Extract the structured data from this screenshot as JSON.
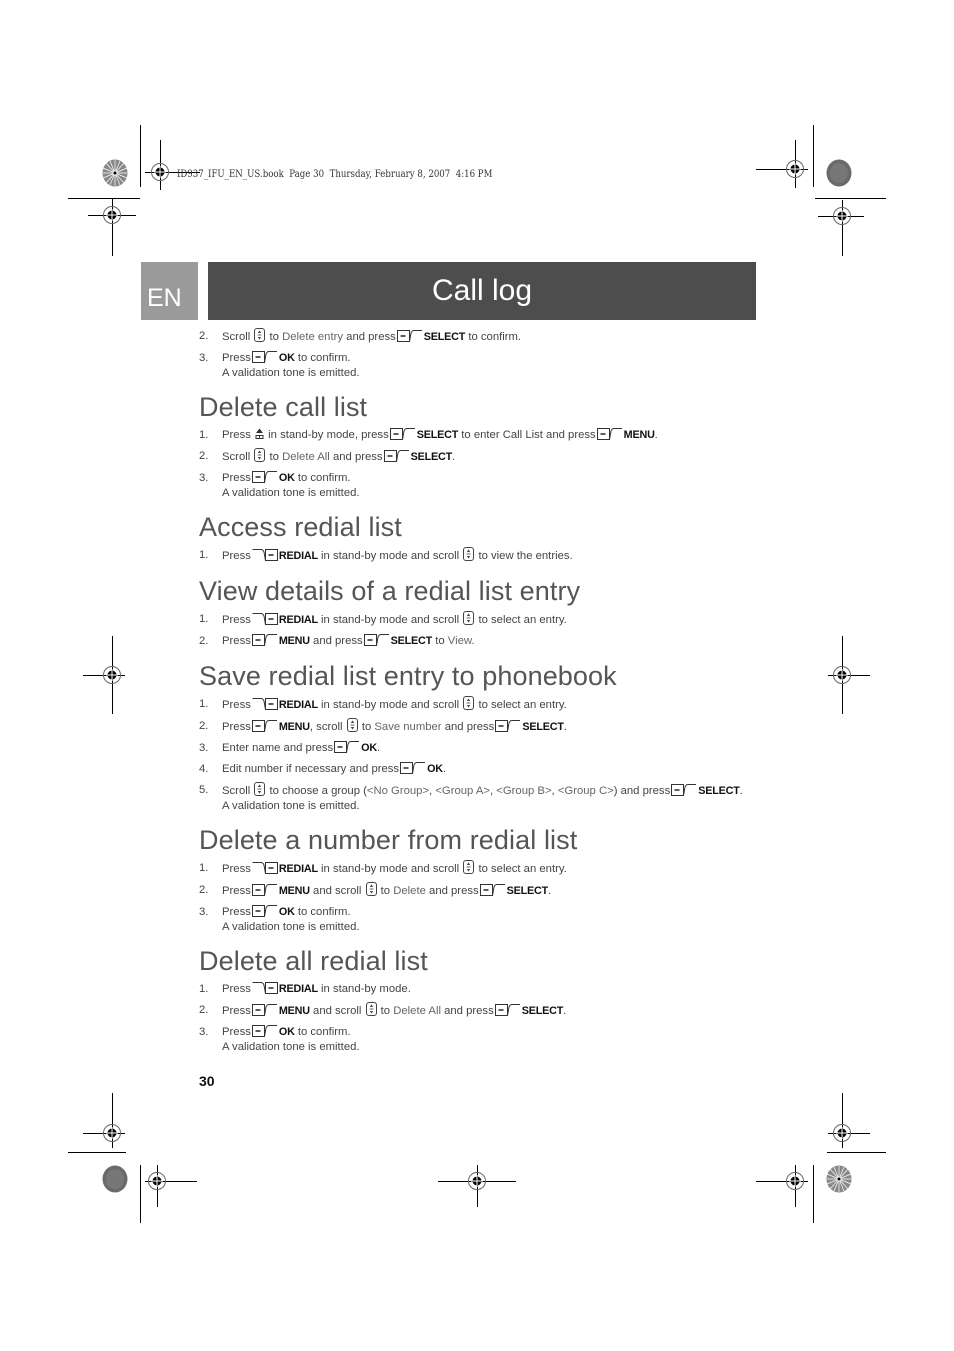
{
  "book_header": "ID937_IFU_EN_US.book  Page 30  Thursday, February 8, 2007  4:16 PM",
  "language_tab": "EN",
  "chapter_title": "Call log",
  "page_number": "30",
  "icons": {
    "scroll": "scroll-key-icon",
    "left_softkey": "left-softkey-icon",
    "right_softkey": "right-softkey-icon",
    "call_log": "call-log-key-icon"
  },
  "intro_steps": [
    {
      "num": "2.",
      "parts": [
        "Scroll",
        "to",
        "Delete entry",
        "and press",
        "SELECT",
        "to confirm."
      ]
    },
    {
      "num": "3.",
      "parts": [
        "Press",
        "OK",
        "to confirm."
      ],
      "note": "A validation tone is emitted."
    }
  ],
  "sections": [
    {
      "title": "Delete call list",
      "steps": [
        {
          "num": "1.",
          "parts": [
            "Press",
            "in stand-by mode, press",
            "SELECT",
            "to enter Call List and press",
            "MENU",
            "."
          ]
        },
        {
          "num": "2.",
          "parts": [
            "Scroll",
            "to",
            "Delete All",
            "and press",
            "SELECT",
            "."
          ]
        },
        {
          "num": "3.",
          "parts": [
            "Press",
            "OK",
            "to confirm."
          ],
          "note": "A validation tone is emitted."
        }
      ]
    },
    {
      "title": "Access redial list",
      "steps": [
        {
          "num": "1.",
          "parts": [
            "Press",
            "REDIAL",
            "in stand-by mode and scroll",
            "to view the entries."
          ]
        }
      ]
    },
    {
      "title": "View details of a redial list entry",
      "steps": [
        {
          "num": "1.",
          "parts": [
            "Press",
            "REDIAL",
            "in stand-by mode and scroll",
            "to select an entry."
          ]
        },
        {
          "num": "2.",
          "parts": [
            "Press",
            "MENU",
            "and press",
            "SELECT",
            "to",
            "View",
            "."
          ]
        }
      ]
    },
    {
      "title": "Save redial list entry to phonebook",
      "steps": [
        {
          "num": "1.",
          "parts": [
            "Press",
            "REDIAL",
            "in stand-by mode and scroll",
            "to select an entry."
          ]
        },
        {
          "num": "2.",
          "parts": [
            "Press",
            "MENU",
            ", scroll",
            "to",
            "Save number",
            "and press",
            "SELECT",
            "."
          ]
        },
        {
          "num": "3.",
          "parts": [
            "Enter name and press",
            "OK",
            "."
          ]
        },
        {
          "num": "4.",
          "parts": [
            "Edit number if necessary and press",
            "OK",
            "."
          ]
        },
        {
          "num": "5.",
          "parts": [
            "Scroll",
            "to choose a group (",
            "<No Group>",
            ", ",
            "<Group A>",
            ", ",
            "<Group B>",
            ", ",
            "<Group C>",
            ") and press",
            "SELECT",
            "."
          ],
          "note": "A validation tone is emitted."
        }
      ]
    },
    {
      "title": "Delete a number from redial list",
      "steps": [
        {
          "num": "1.",
          "parts": [
            "Press",
            "REDIAL",
            "in stand-by mode and scroll",
            "to select an entry."
          ]
        },
        {
          "num": "2.",
          "parts": [
            "Press",
            "MENU",
            "and scroll",
            "to",
            "Delete",
            "and press",
            "SELECT",
            "."
          ]
        },
        {
          "num": "3.",
          "parts": [
            "Press",
            "OK",
            "to confirm."
          ],
          "note": "A validation tone is emitted."
        }
      ]
    },
    {
      "title": "Delete all redial list",
      "steps": [
        {
          "num": "1.",
          "parts": [
            "Press",
            "REDIAL",
            "in stand-by mode."
          ]
        },
        {
          "num": "2.",
          "parts": [
            "Press",
            "MENU",
            "and scroll",
            "to",
            "Delete All",
            "and press",
            "SELECT",
            "."
          ]
        },
        {
          "num": "3.",
          "parts": [
            "Press",
            "OK",
            "to confirm."
          ],
          "note": "A validation tone is emitted."
        }
      ]
    }
  ]
}
